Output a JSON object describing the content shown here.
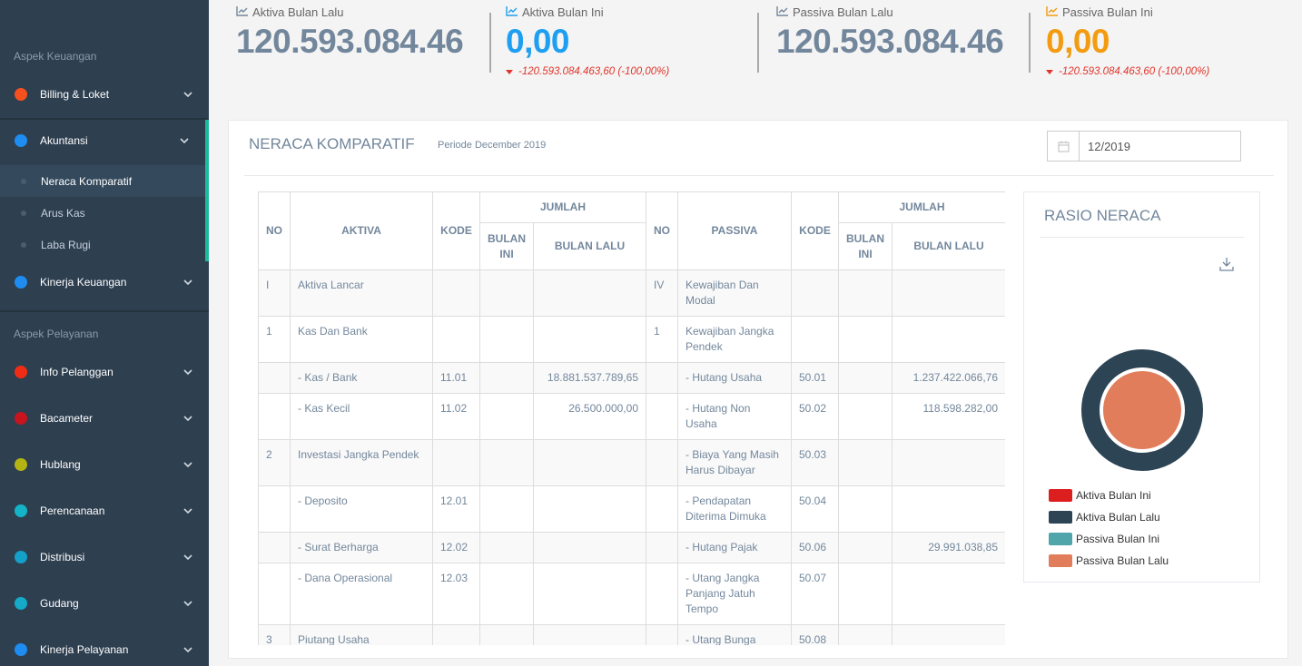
{
  "sidebar": {
    "section1": "Aspek Keuangan",
    "section2": "Aspek Pelayanan",
    "items1": [
      {
        "label": "Billing & Loket",
        "color": "#f5501e"
      },
      {
        "label": "Akuntansi",
        "color": "#1e8cf0"
      },
      {
        "label": "Kinerja Keuangan",
        "color": "#1e8cf0"
      }
    ],
    "subitems": [
      "Neraca Komparatif",
      "Arus Kas",
      "Laba Rugi"
    ],
    "items2": [
      {
        "label": "Info Pelanggan",
        "color": "#f02d14"
      },
      {
        "label": "Bacameter",
        "color": "#c8141e"
      },
      {
        "label": "Hublang",
        "color": "#b4b414"
      },
      {
        "label": "Perencanaan",
        "color": "#14b4c8"
      },
      {
        "label": "Distribusi",
        "color": "#14a0c8"
      },
      {
        "label": "Gudang",
        "color": "#14aac8"
      },
      {
        "label": "Kinerja Pelayanan",
        "color": "#1e8cf0"
      }
    ]
  },
  "stats": [
    {
      "title": "Aktiva Bulan Lalu",
      "value": "120.593.084.46",
      "color": "#73879c",
      "change": ""
    },
    {
      "title": "Aktiva Bulan Ini",
      "value": "0,00",
      "color": "#1e9ff2",
      "change": "-120.593.084.463,60 (-100,00%)"
    },
    {
      "title": "Passiva Bulan Lalu",
      "value": "120.593.084.46",
      "color": "#73879c",
      "change": ""
    },
    {
      "title": "Passiva Bulan Ini",
      "value": "0,00",
      "color": "#f39c12",
      "change": "-120.593.084.463,60 (-100,00%)"
    }
  ],
  "panel": {
    "title": "NERACA KOMPARATIF",
    "subtitle": "Periode December 2019",
    "date_value": "12/2019"
  },
  "table": {
    "h_no": "NO",
    "h_aktiva": "AKTIVA",
    "h_kode": "KODE",
    "h_jumlah": "JUMLAH",
    "h_bulan_ini": "BULAN INI",
    "h_bulan_lalu": "BULAN LALU",
    "h_passiva": "PASSIVA",
    "rows": [
      [
        "I",
        "Aktiva Lancar",
        "",
        "",
        "",
        "IV",
        "Kewajiban Dan Modal",
        "",
        "",
        ""
      ],
      [
        "1",
        "Kas Dan Bank",
        "",
        "",
        "",
        "1",
        "Kewajiban Jangka Pendek",
        "",
        "",
        ""
      ],
      [
        "",
        "- Kas / Bank",
        "11.01",
        "",
        "18.881.537.789,65",
        "",
        "- Hutang Usaha",
        "50.01",
        "",
        "1.237.422.066,76"
      ],
      [
        "",
        "- Kas Kecil",
        "11.02",
        "",
        "26.500.000,00",
        "",
        "- Hutang Non Usaha",
        "50.02",
        "",
        "118.598.282,00"
      ],
      [
        "2",
        "Investasi Jangka Pendek",
        "",
        "",
        "",
        "",
        "- Biaya Yang Masih Harus Dibayar",
        "50.03",
        "",
        ""
      ],
      [
        "",
        "- Deposito",
        "12.01",
        "",
        "",
        "",
        "- Pendapatan Diterima Dimuka",
        "50.04",
        "",
        ""
      ],
      [
        "",
        "- Surat Berharga",
        "12.02",
        "",
        "",
        "",
        "- Hutang Pajak",
        "50.06",
        "",
        "29.991.038,85"
      ],
      [
        "",
        "- Dana Operasional",
        "12.03",
        "",
        "",
        "",
        "- Utang Jangka Panjang Jatuh Tempo",
        "50.07",
        "",
        ""
      ],
      [
        "3",
        "Piutang Usaha",
        "",
        "",
        "",
        "",
        "- Utang Bunga",
        "50.08",
        "",
        ""
      ]
    ]
  },
  "chart": {
    "title": "RASIO NERACA"
  },
  "chart_data": {
    "type": "pie",
    "series": [
      {
        "name": "Aktiva Bulan Ini",
        "value": 0,
        "color": "#dc1e1e"
      },
      {
        "name": "Aktiva Bulan Lalu",
        "value": 120593084463.6,
        "color": "#2d4455"
      },
      {
        "name": "Passiva Bulan Ini",
        "value": 0,
        "color": "#50a5aa"
      },
      {
        "name": "Passiva Bulan Lalu",
        "value": 120593084463.6,
        "color": "#e17d5a"
      }
    ]
  }
}
